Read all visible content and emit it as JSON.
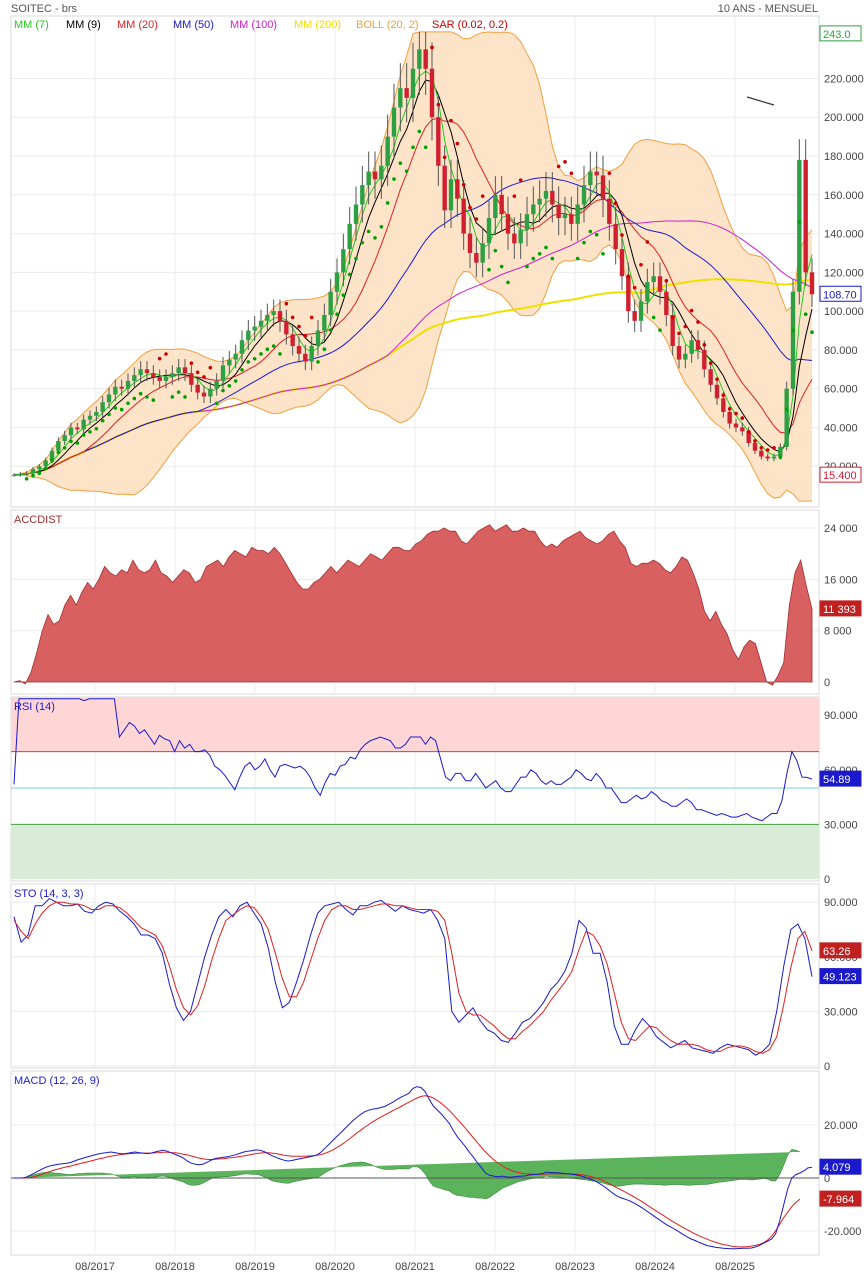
{
  "header": {
    "ticker": "SOITEC - brs",
    "period": "10 ANS - MENSUEL"
  },
  "colors": {
    "mm7": "#22cc22",
    "mm9": "#000000",
    "mm20": "#e02020",
    "mm50": "#1a1acc",
    "mm100": "#cc22cc",
    "mm200": "#f0e000",
    "boll": "#f0a040",
    "boll_fill": "#fde3c8",
    "sar": "#cc0000",
    "sar_low": "#00a000",
    "up": "#2ea043",
    "down": "#d02030",
    "accdist": "#d96060",
    "rsi_high_zone": "#ffd6d6",
    "rsi_low_zone": "#d8ecd8",
    "rsi_line": "#1a1acc",
    "sto_k": "#1a1acc",
    "sto_d": "#e02020",
    "macd": "#1a1acc",
    "signal": "#e02020",
    "hist": "#5bb35b"
  },
  "chart_data": [
    {
      "type": "candlestick",
      "panel": "price",
      "legend": [
        "MM (7)",
        "MM (9)",
        "MM (20)",
        "MM (50)",
        "MM (100)",
        "MM (200)",
        "BOLL (20, 2)",
        "SAR (0.02, 0.2)"
      ],
      "y_ticks": [
        "20.000",
        "40.000",
        "60.000",
        "80.000",
        "100.000",
        "120.000",
        "140.000",
        "160.000",
        "180.000",
        "200.000",
        "220.000"
      ],
      "ylim": [
        0,
        245
      ],
      "last_labels": {
        "high": "243.0",
        "close": "108.70",
        "low": "15.400"
      },
      "x_ticks": [
        "08/2017",
        "08/2018",
        "08/2019",
        "08/2020",
        "08/2021",
        "08/2022",
        "08/2023",
        "08/2024",
        "08/2025"
      ],
      "closes": [
        15.5,
        16,
        16.5,
        18.5,
        20,
        23,
        28,
        33,
        36,
        40,
        39,
        44,
        46,
        48,
        53,
        57,
        61,
        60,
        64,
        67,
        70,
        68,
        66,
        64,
        66,
        68,
        71,
        68,
        62,
        58,
        56,
        60,
        64,
        72,
        75,
        78,
        85,
        90,
        92,
        95,
        98,
        100,
        95,
        88,
        82,
        78,
        74,
        82,
        90,
        98,
        110,
        120,
        132,
        145,
        155,
        165,
        172,
        168,
        175,
        190,
        205,
        215,
        210,
        225,
        235,
        225,
        200,
        175,
        152,
        168,
        158,
        140,
        130,
        125,
        135,
        148,
        160,
        150,
        140,
        135,
        142,
        150,
        155,
        158,
        162,
        155,
        148,
        150,
        145,
        155,
        165,
        172,
        170,
        158,
        145,
        132,
        118,
        100,
        95,
        105,
        115,
        118,
        110,
        98,
        82,
        75,
        78,
        85,
        80,
        70,
        62,
        55,
        48,
        42,
        40,
        38,
        32,
        28,
        25,
        24,
        25,
        30,
        60,
        110,
        178,
        120,
        108.7
      ],
      "sar_points_count": 127
    },
    {
      "type": "area",
      "panel": "ACCDIST",
      "label": "ACCDIST",
      "y_ticks": [
        "0",
        "8 000",
        "16 000",
        "24 000"
      ],
      "ylim": [
        -1000,
        26000
      ],
      "last_label": "11 393",
      "values": [
        0,
        200,
        -300,
        1500,
        4500,
        8000,
        10500,
        9000,
        9500,
        12000,
        13500,
        12000,
        14000,
        15500,
        14500,
        16000,
        18000,
        17000,
        16500,
        17500,
        17000,
        19000,
        17500,
        17000,
        17500,
        19000,
        17000,
        16500,
        15500,
        16500,
        17500,
        17000,
        15500,
        16000,
        18000,
        18500,
        19000,
        18000,
        19500,
        20500,
        20000,
        19500,
        21000,
        20500,
        20500,
        20000,
        21000,
        20000,
        18500,
        17000,
        15500,
        14500,
        14500,
        15500,
        16000,
        17000,
        18000,
        17000,
        18000,
        19000,
        18500,
        18000,
        19000,
        20000,
        19500,
        19000,
        20000,
        21000,
        21000,
        20500,
        20500,
        21500,
        22000,
        23000,
        23500,
        23500,
        24000,
        23500,
        23500,
        22000,
        21500,
        22500,
        23500,
        24000,
        24500,
        23500,
        24000,
        24500,
        23500,
        23500,
        24000,
        23500,
        23500,
        22000,
        21000,
        21500,
        21000,
        22000,
        22500,
        23000,
        23500,
        22500,
        22000,
        21500,
        22000,
        23000,
        23500,
        22000,
        21000,
        18500,
        18000,
        18500,
        18500,
        19000,
        18500,
        17500,
        17000,
        18000,
        19500,
        19000,
        17000,
        14500,
        11000,
        9500,
        11000,
        9000,
        7500,
        5000,
        3500,
        5500,
        6500,
        6000,
        3000,
        0,
        -500,
        1000,
        3000,
        12000,
        17000,
        19000,
        15000,
        11393
      ],
      "area_note": ""
    },
    {
      "type": "line",
      "panel": "RSI",
      "label": "RSI (14)",
      "y_ticks": [
        "0",
        "30.000",
        "60.000",
        "90.000"
      ],
      "ylim": [
        0,
        100
      ],
      "levels": [
        30,
        70
      ],
      "last_label": "54.89",
      "values": [
        52,
        100,
        100,
        100,
        100,
        100,
        100,
        100,
        100,
        100,
        100,
        100,
        100,
        100,
        98,
        100,
        100,
        100,
        100,
        100,
        100,
        78,
        82,
        86,
        84,
        80,
        82,
        78,
        74,
        79,
        77,
        76,
        70,
        76,
        72,
        74,
        70,
        70,
        71,
        68,
        62,
        60,
        57,
        53,
        49,
        56,
        62,
        64,
        60,
        62,
        66,
        60,
        56,
        62,
        63,
        62,
        61,
        62,
        60,
        56,
        50,
        46,
        53,
        58,
        57,
        62,
        63,
        67,
        66,
        71,
        74,
        76,
        77,
        78,
        77,
        76,
        72,
        72,
        74,
        78,
        78,
        78,
        74,
        78,
        76,
        66,
        56,
        54,
        58,
        58,
        54,
        54,
        58,
        54,
        50,
        52,
        54,
        50,
        48,
        48,
        52,
        56,
        56,
        60,
        58,
        54,
        52,
        54,
        52,
        52,
        54,
        56,
        60,
        58,
        55,
        54,
        58,
        55,
        50,
        50,
        46,
        42,
        42,
        44,
        46,
        44,
        45,
        48,
        46,
        43,
        42,
        40,
        40,
        42,
        44,
        42,
        38,
        38,
        37,
        36,
        35,
        36,
        35,
        34,
        34,
        35,
        36,
        34,
        33,
        32,
        34,
        36,
        36,
        43,
        58,
        70,
        65,
        56,
        55.8,
        54.89
      ],
      "zone_note": ""
    },
    {
      "type": "line",
      "panel": "STO",
      "label": "STO (14, 3, 3)",
      "y_ticks": [
        "0",
        "30.000",
        "60.000",
        "90.000"
      ],
      "ylim": [
        0,
        100
      ],
      "last_labels": {
        "d": "63.26",
        "k": "49.123"
      },
      "series": [
        {
          "name": "K",
          "values": [
            82,
            68,
            72,
            88,
            88,
            92,
            90,
            88,
            88,
            89,
            85,
            84,
            88,
            90,
            89,
            85,
            82,
            78,
            72,
            72,
            70,
            62,
            45,
            32,
            25,
            30,
            45,
            60,
            72,
            82,
            86,
            82,
            88,
            90,
            84,
            78,
            65,
            46,
            32,
            35,
            46,
            58,
            72,
            84,
            88,
            89,
            90,
            86,
            83,
            88,
            88,
            90,
            91,
            88,
            85,
            88,
            86,
            85,
            84,
            86,
            80,
            70,
            30,
            24,
            28,
            32,
            25,
            20,
            18,
            14,
            13,
            18,
            24,
            26,
            30,
            35,
            42,
            46,
            52,
            62,
            80,
            76,
            62,
            62,
            46,
            22,
            12,
            12,
            20,
            26,
            22,
            16,
            13,
            10,
            12,
            14,
            10,
            9,
            8,
            7,
            10,
            12,
            11,
            10,
            9,
            6,
            8,
            12,
            30,
            55,
            75,
            78,
            70,
            49.123
          ]
        },
        {
          "name": "D",
          "values": [
            80,
            74,
            70,
            78,
            84,
            88,
            90,
            90,
            89,
            89,
            88,
            86,
            86,
            88,
            88,
            87,
            84,
            80,
            76,
            74,
            72,
            66,
            55,
            42,
            32,
            28,
            33,
            44,
            58,
            70,
            80,
            83,
            86,
            88,
            87,
            82,
            75,
            62,
            48,
            38,
            38,
            46,
            58,
            70,
            80,
            86,
            88,
            88,
            86,
            86,
            87,
            88,
            89,
            89,
            88,
            88,
            87,
            86,
            86,
            86,
            85,
            80,
            62,
            40,
            30,
            28,
            28,
            25,
            22,
            18,
            15,
            15,
            19,
            22,
            26,
            30,
            36,
            41,
            46,
            52,
            64,
            74,
            72,
            66,
            56,
            40,
            24,
            15,
            14,
            18,
            22,
            21,
            17,
            14,
            12,
            12,
            12,
            11,
            9,
            8,
            8,
            10,
            11,
            11,
            10,
            8,
            7,
            9,
            16,
            34,
            54,
            70,
            74,
            63.26
          ]
        }
      ]
    },
    {
      "type": "line+bar",
      "panel": "MACD",
      "label": "MACD (12, 26, 9)",
      "y_ticks": [
        "-20.000",
        "0",
        "20.000"
      ],
      "ylim": [
        -27,
        34
      ],
      "last_labels": {
        "macd": "4.079",
        "signal": "-7.964"
      },
      "series": [
        {
          "name": "MACD",
          "values": [
            0,
            0,
            0,
            0.3,
            1,
            1.8,
            2.6,
            3.4,
            4.1,
            4.6,
            4.9,
            5.2,
            5.4,
            5.6,
            5.8,
            6.4,
            7,
            7.4,
            7.9,
            8.3,
            8.7,
            9.1,
            9.4,
            9.6,
            9.8,
            9.6,
            9.3,
            9.1,
            9.3,
            9.6,
            9.8,
            9.6,
            9.4,
            9.2,
            9.4,
            9.8,
            10.2,
            10.5,
            10.1,
            9.5,
            8.9,
            8.3,
            7.5,
            6.4,
            5.6,
            5.2,
            5,
            5.3,
            6,
            6.8,
            7.4,
            7.6,
            7.8,
            8,
            8.4,
            8.8,
            9.3,
            9.8,
            10.1,
            10.3,
            10.6,
            10.5,
            10,
            9.3,
            8.4,
            7.8,
            7.2,
            6.7,
            6.4,
            6.6,
            7,
            7.3,
            7.6,
            7.9,
            8.2,
            8.6,
            9.5,
            11,
            12.5,
            14,
            15.5,
            17,
            18.5,
            20,
            21.5,
            22.8,
            24,
            25,
            25.6,
            26,
            26.2,
            26.6,
            27,
            27.8,
            28.6,
            29.6,
            30.5,
            31.2,
            32,
            33.8,
            34.5,
            34.1,
            32.6,
            29.8,
            27.2,
            25.7,
            24.2,
            22.4,
            20.6,
            17.9,
            15.6,
            13.7,
            11.8,
            9.7,
            7.8,
            5.7,
            3.9,
            1.9,
            1,
            0.7,
            0.5,
            0.7,
            0.5,
            0.3,
            0.4,
            0.6,
            0.7,
            0.8,
            1.2,
            1.3,
            1.4,
            1.6,
            2.2,
            2.1,
            2,
            2,
            1.8,
            1.6,
            1.5,
            1.3,
            1,
            0.6,
            0.2,
            -0.4,
            -1,
            -1.8,
            -2.8,
            -3.9,
            -5.1,
            -6.2,
            -7.1,
            -7.7,
            -8.2,
            -8.8,
            -9.6,
            -10.5,
            -11.4,
            -12.5,
            -13.5,
            -14.6,
            -15.6,
            -16.7,
            -17.7,
            -18.5,
            -19.4,
            -20.3,
            -21.3,
            -22.2,
            -23,
            -23.6,
            -24.3,
            -24.9,
            -25.5,
            -25.8,
            -26.1,
            -26.3,
            -26.5,
            -26.6,
            -26.7,
            -26.7,
            -26.6,
            -26.5,
            -26.5,
            -26.4,
            -26,
            -25.4,
            -24.6,
            -23.8,
            -23,
            -21,
            -16,
            -10,
            -4,
            0,
            1.3,
            1.9,
            2.7,
            3.8,
            4.079
          ]
        },
        {
          "name": "Signal",
          "values": [
            0,
            0,
            0,
            0,
            0.2,
            0.5,
            0.9,
            1.4,
            2,
            2.5,
            3,
            3.4,
            3.8,
            4.2,
            4.5,
            4.9,
            5.3,
            5.7,
            6,
            6.4,
            6.8,
            7.2,
            7.5,
            7.9,
            8.2,
            8.5,
            8.7,
            8.9,
            9.1,
            9.2,
            9.3,
            9.4,
            9.4,
            9.4,
            9.4,
            9.5,
            9.6,
            9.7,
            9.7,
            9.6,
            9.5,
            9.3,
            9,
            8.7,
            8.3,
            7.9,
            7.5,
            7.2,
            7,
            7,
            7.1,
            7.2,
            7.3,
            7.5,
            7.7,
            7.9,
            8.1,
            8.3,
            8.6,
            8.9,
            9.2,
            9.4,
            9.5,
            9.5,
            9.4,
            9.2,
            8.9,
            8.6,
            8.4,
            8.2,
            8.2,
            8.2,
            8.2,
            8.3,
            8.4,
            8.6,
            8.8,
            9.2,
            9.8,
            10.5,
            11.4,
            12.3,
            13.4,
            14.5,
            15.7,
            16.9,
            18,
            19.1,
            20.2,
            21.2,
            22.1,
            23,
            23.8,
            24.6,
            25.4,
            26.2,
            27,
            27.8,
            28.6,
            29.4,
            30.2,
            30.8,
            31,
            30.8,
            30.2,
            29.3,
            28.2,
            26.9,
            25.5,
            23.9,
            22.2,
            20.5,
            18.8,
            17,
            15.1,
            13.3,
            11.5,
            9.8,
            8.3,
            6.9,
            5.7,
            4.7,
            3.8,
            3.1,
            2.5,
            2.1,
            1.8,
            1.6,
            1.5,
            1.4,
            1.4,
            1.4,
            1.5,
            1.6,
            1.6,
            1.6,
            1.6,
            1.6,
            1.6,
            1.5,
            1.4,
            1.2,
            0.9,
            0.6,
            0.2,
            -0.3,
            -0.9,
            -1.6,
            -2.4,
            -3.2,
            -4,
            -4.8,
            -5.6,
            -6.4,
            -7.3,
            -8.2,
            -9.1,
            -10.1,
            -11.1,
            -12.1,
            -13.1,
            -14,
            -15,
            -16,
            -16.9,
            -17.8,
            -18.7,
            -19.5,
            -20.3,
            -21.1,
            -21.8,
            -22.5,
            -23.1,
            -23.7,
            -24.2,
            -24.7,
            -25.1,
            -25.4,
            -25.7,
            -25.9,
            -26,
            -26,
            -25.9,
            -25.7,
            -25.4,
            -25,
            -24.4,
            -23.4,
            -21.9,
            -19.9,
            -17.4,
            -14.9,
            -12.8,
            -10.8,
            -9.2,
            -7.964
          ]
        }
      ]
    }
  ]
}
